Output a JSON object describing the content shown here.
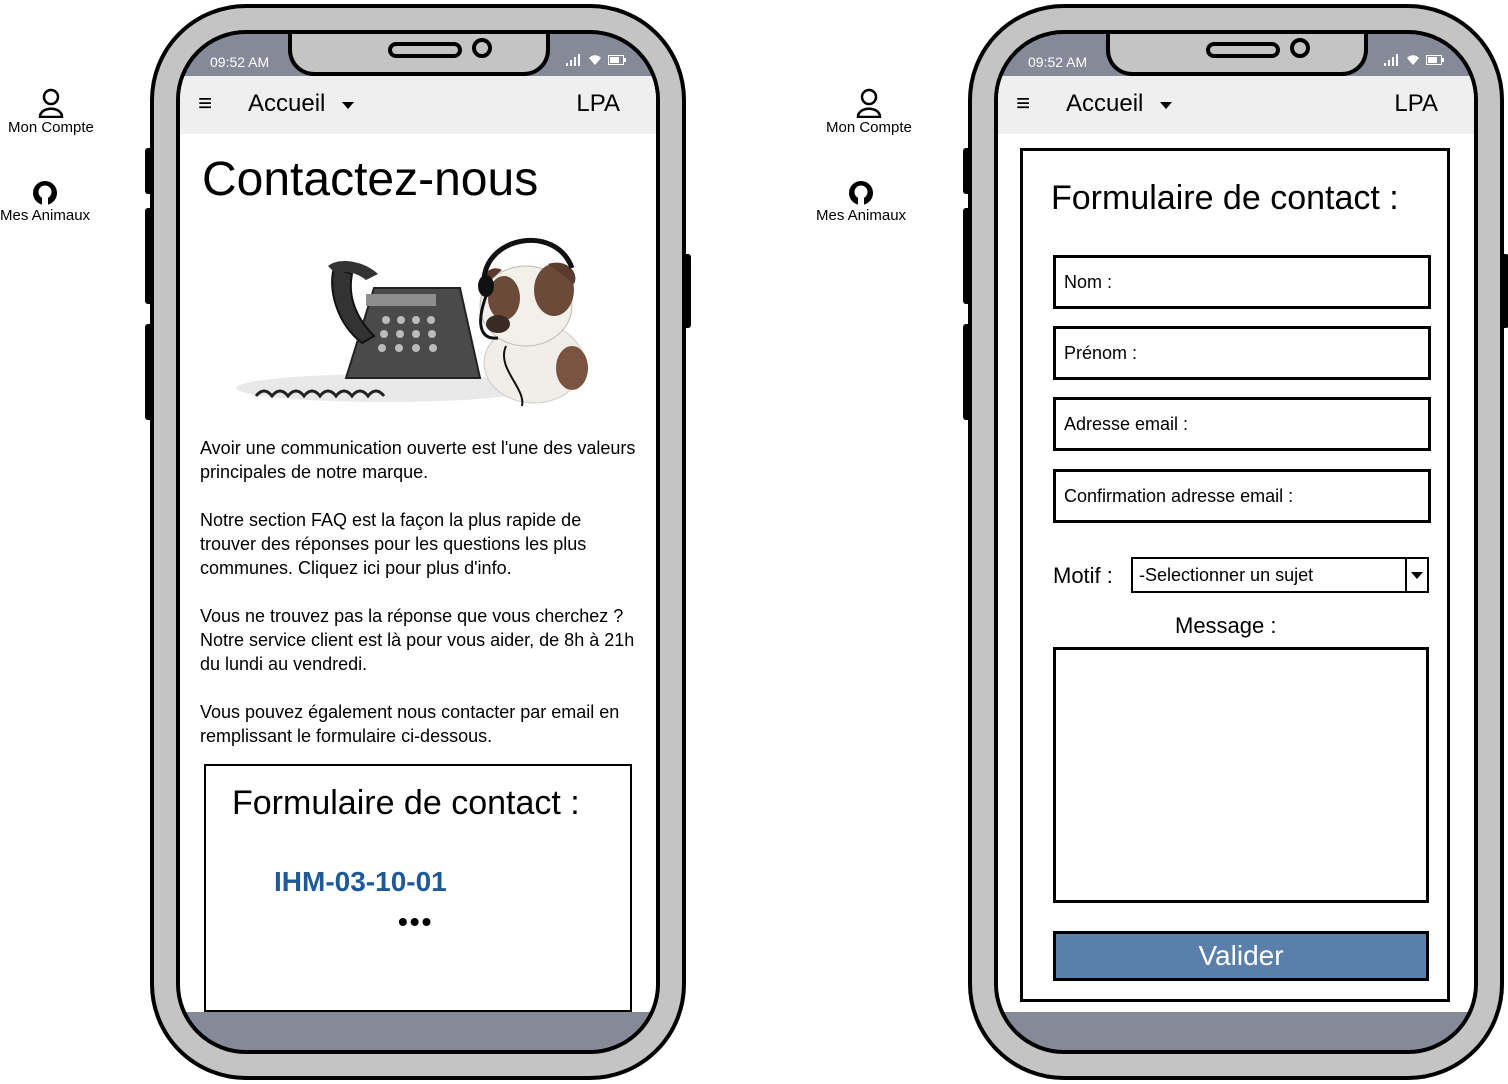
{
  "sidebar": {
    "items": [
      {
        "label": "Mon Compte",
        "icon": "user-icon"
      },
      {
        "label": "Mes Animaux",
        "icon": "github-icon"
      }
    ]
  },
  "status": {
    "time": "09:52 AM"
  },
  "navbar": {
    "menu_icon": "≡",
    "title": "Accueil",
    "brand": "LPA"
  },
  "contact_page": {
    "title": "Contactez-nous",
    "image": "phone-and-puppy-photo",
    "paragraphs": [
      "Avoir une communication ouverte est l'une des valeurs principales de notre marque.",
      "Notre section FAQ est la façon la plus rapide de trouver des réponses pour les questions les plus communes. Cliquez ici pour plus d'info.",
      "Vous ne trouvez pas la réponse que vous cherchez ? Notre service client est là pour vous aider, de 8h à 21h du lundi au vendredi.",
      "Vous pouvez également nous contacter par email en remplissant le formulaire ci-dessous."
    ],
    "form_card": {
      "title": "Formulaire de contact :",
      "reference": "IHM-03-10-01",
      "more": "•••"
    }
  },
  "contact_form": {
    "title": "Formulaire de contact :",
    "fields": [
      {
        "label": "Nom :"
      },
      {
        "label": "Prénom :"
      },
      {
        "label": "Adresse email :"
      },
      {
        "label": "Confirmation adresse email :"
      }
    ],
    "motif_label": "Motif :",
    "motif_selected": "-Selectionner un sujet",
    "message_label": "Message :",
    "message_value": "",
    "submit_label": "Valider"
  },
  "colors": {
    "submit_bg": "#5a7fab",
    "reference_text": "#1e5a9a",
    "navbar_bg": "#efefef",
    "phone_frame": "#c4c4c4"
  }
}
